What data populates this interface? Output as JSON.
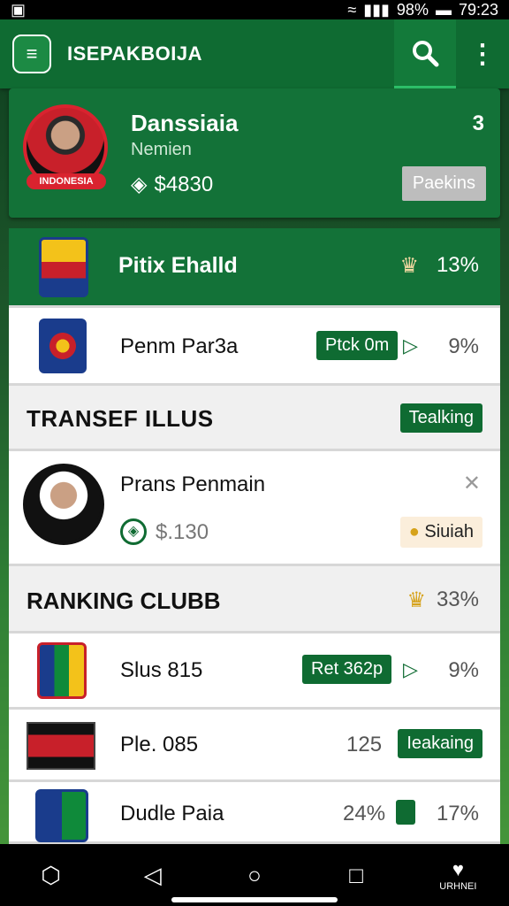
{
  "status": {
    "battery": "98%",
    "time": "79:23"
  },
  "app": {
    "title": "ISEPAKBOIJA"
  },
  "profile": {
    "name": "Danssiaia",
    "role": "Nemien",
    "money": "$4830",
    "count": "3",
    "button": "Paekins",
    "band": "INDONESIA"
  },
  "rows": [
    {
      "name": "Pitix Ehalld",
      "pct": "13%"
    },
    {
      "name": "Penm Par3a",
      "pill": "Ptck 0m",
      "pct": "9%"
    },
    {
      "header": "TRANSEF ILLUS",
      "pill": "Tealking"
    },
    {
      "name": "Prans Penmain",
      "money": "$.130",
      "tag": "Siuiah"
    },
    {
      "header": "RANKING CLUBB",
      "pct": "33%"
    },
    {
      "name": "Slus 815",
      "pill": "Ret 362p",
      "pct": "9%"
    },
    {
      "name": "Ple. 085",
      "num": "125",
      "pill": "Ieakaing"
    },
    {
      "name": "Dudle Paia",
      "pct": "24%",
      "pct2": "17%"
    }
  ],
  "nav": {
    "label": "URHNEI"
  }
}
